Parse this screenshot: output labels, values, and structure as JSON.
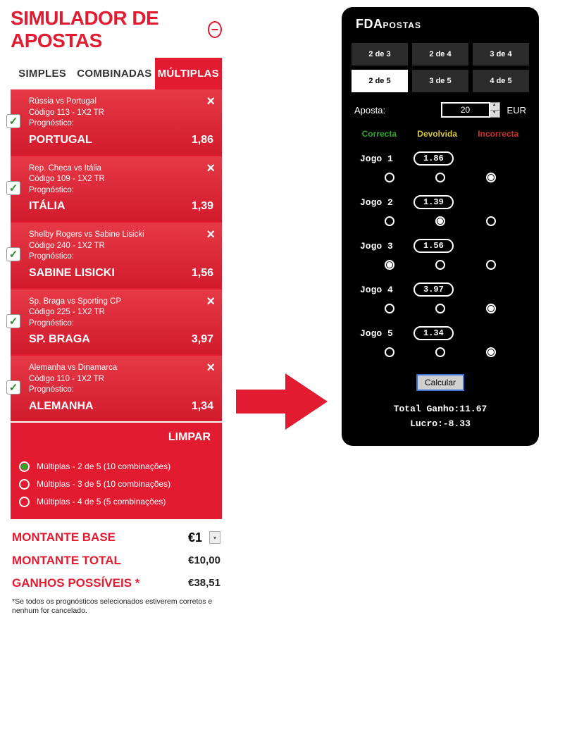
{
  "header": {
    "title": "SIMULADOR DE APOSTAS"
  },
  "tabs": {
    "simples": "SIMPLES",
    "combinadas": "COMBINADAS",
    "multiplas": "MÚLTIPLAS"
  },
  "bets": [
    {
      "match": "Rússia vs Portugal",
      "code": "Código 113 - 1X2 TR",
      "prog": "Prognóstico:",
      "pick": "PORTUGAL",
      "odds": "1,86"
    },
    {
      "match": "Rep. Checa vs Itália",
      "code": "Código 109 - 1X2 TR",
      "prog": "Prognóstico:",
      "pick": "ITÁLIA",
      "odds": "1,39"
    },
    {
      "match": "Shelby Rogers vs Sabine Lisicki",
      "code": "Código 240 - 1X2 TR",
      "prog": "Prognóstico:",
      "pick": "SABINE LISICKI",
      "odds": "1,56"
    },
    {
      "match": "Sp. Braga vs Sporting CP",
      "code": "Código 225 - 1X2 TR",
      "prog": "Prognóstico:",
      "pick": "SP. BRAGA",
      "odds": "3,97"
    },
    {
      "match": "Alemanha vs Dinamarca",
      "code": "Código 110 - 1X2 TR",
      "prog": "Prognóstico:",
      "pick": "ALEMANHA",
      "odds": "1,34"
    }
  ],
  "limpar": "LIMPAR",
  "combinations": [
    {
      "label": "Múltiplas - 2 de 5 (10 combinações)",
      "selected": true
    },
    {
      "label": "Múltiplas - 3 de 5 (10 combinações)",
      "selected": false
    },
    {
      "label": "Múltiplas - 4 de 5 (5 combinações)",
      "selected": false
    }
  ],
  "summary": {
    "base_label": "MONTANTE BASE",
    "base_value": "€1",
    "total_label": "MONTANTE TOTAL",
    "total_value": "€10,00",
    "ganhos_label": "GANHOS POSSÍVEIS *",
    "ganhos_value": "€38,51",
    "footnote": "*Se todos os prognósticos selecionados estiverem corretos e nenhum for cancelado."
  },
  "right": {
    "brand_big": "FDA",
    "brand_small": "POSTAS",
    "modes": [
      {
        "label": "2 de 3",
        "active": false
      },
      {
        "label": "2 de 4",
        "active": false
      },
      {
        "label": "3 de 4",
        "active": false
      },
      {
        "label": "2 de 5",
        "active": true
      },
      {
        "label": "3 de 5",
        "active": false
      },
      {
        "label": "4 de 5",
        "active": false
      }
    ],
    "aposta_label": "Aposta:",
    "aposta_value": "20",
    "aposta_currency": "EUR",
    "legend": {
      "c": "Correcta",
      "d": "Devolvida",
      "i": "Incorrecta"
    },
    "games": [
      {
        "name": "Jogo 1",
        "odd": "1.86",
        "sel": 2
      },
      {
        "name": "Jogo 2",
        "odd": "1.39",
        "sel": 1
      },
      {
        "name": "Jogo 3",
        "odd": "1.56",
        "sel": 0
      },
      {
        "name": "Jogo 4",
        "odd": "3.97",
        "sel": 2
      },
      {
        "name": "Jogo 5",
        "odd": "1.34",
        "sel": 2
      }
    ],
    "calc_label": "Calcular",
    "total_line": "Total Ganho:11.67",
    "lucro_line": "Lucro:-8.33"
  }
}
